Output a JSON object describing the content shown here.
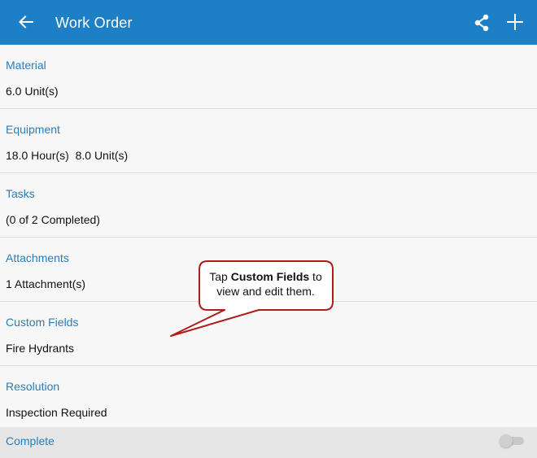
{
  "appbar": {
    "title": "Work Order",
    "back_icon": "arrow-left-icon",
    "share_icon": "share-icon",
    "add_icon": "plus-icon",
    "color": "#1d7fc6"
  },
  "sections": [
    {
      "label": "Material",
      "value": "6.0 Unit(s)"
    },
    {
      "label": "Equipment",
      "value": "18.0 Hour(s)  8.0 Unit(s)"
    },
    {
      "label": "Tasks",
      "value": "(0 of 2 Completed)"
    },
    {
      "label": "Attachments",
      "value": "1 Attachment(s)"
    },
    {
      "label": "Custom Fields",
      "value": "Fire Hydrants"
    },
    {
      "label": "Resolution",
      "value": "Inspection Required"
    }
  ],
  "complete": {
    "label": "Complete",
    "toggle_on": false
  },
  "callout": {
    "prefix": "Tap ",
    "bold": "Custom Fields",
    "suffix": " to view and edit them.",
    "border_color": "#b01c1c"
  },
  "colors": {
    "label_blue": "#2b7db7",
    "background": "#f7f7f7"
  }
}
